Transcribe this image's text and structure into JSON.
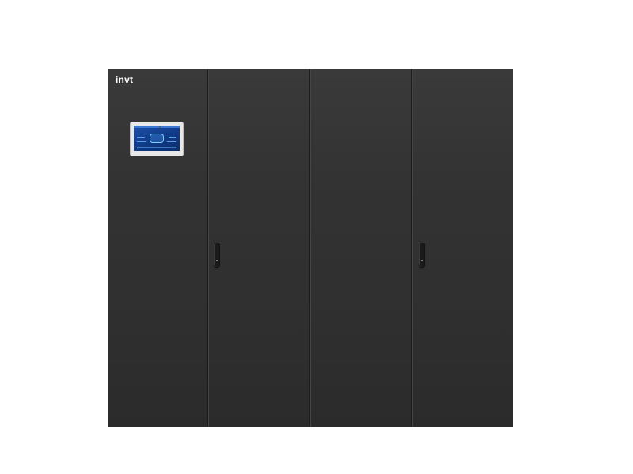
{
  "product": {
    "brand_logo": "invt",
    "cabinet": {
      "doors": [
        "door-1",
        "door-2",
        "door-3",
        "door-4"
      ],
      "body_color": "#2e2e2e"
    },
    "display": {
      "screen_color": "#1d4fa8",
      "icon": "touchscreen-icon"
    },
    "handles": [
      "handle-door-2",
      "handle-door-4"
    ]
  }
}
